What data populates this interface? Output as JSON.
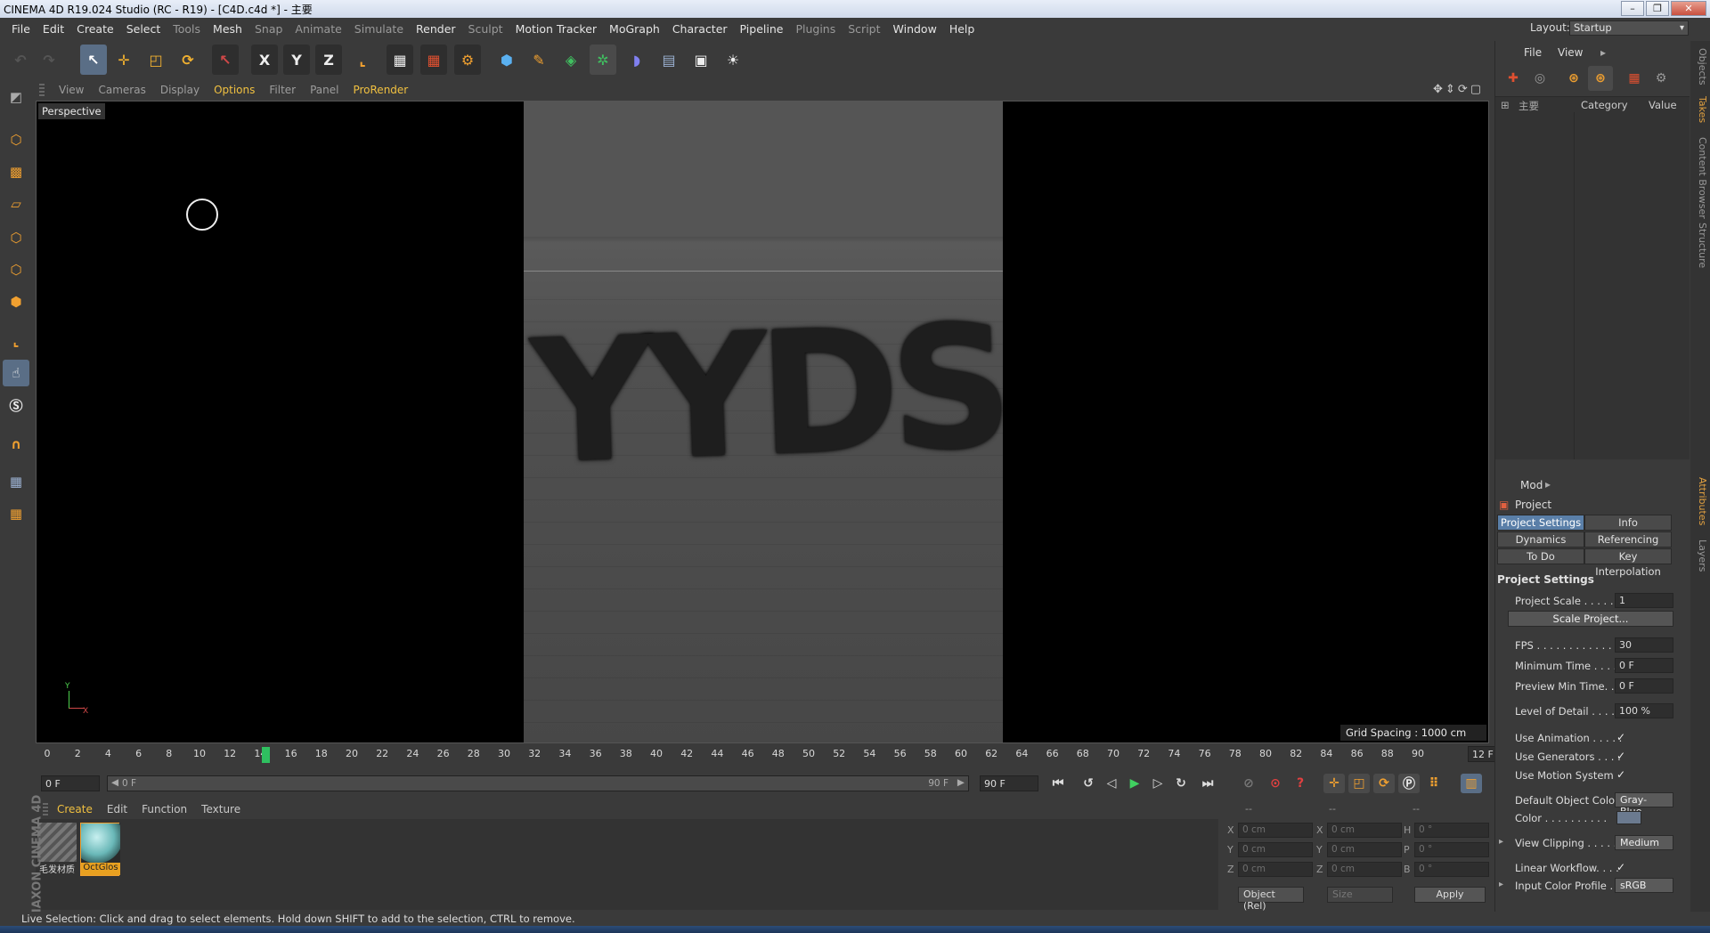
{
  "window": {
    "title": "CINEMA 4D R19.024 Studio (RC - R19) - [C4D.c4d *] - 主要",
    "buttons": [
      "–",
      "❐",
      "✕"
    ]
  },
  "menubar": {
    "items": [
      "File",
      "Edit",
      "Create",
      "Select",
      "Tools",
      "Mesh",
      "Snap",
      "Animate",
      "Simulate",
      "Render",
      "Sculpt",
      "Motion Tracker",
      "MoGraph",
      "Character",
      "Pipeline",
      "Plugins",
      "Script",
      "Window",
      "Help"
    ],
    "layout_label": "Layout:",
    "layout_value": "Startup"
  },
  "toolbar": {
    "icons": [
      "undo-icon",
      "redo-icon",
      "live-selection-icon",
      "move-icon",
      "scale-icon",
      "rotate-icon",
      "recent-tool-icon",
      "x-axis-icon",
      "y-axis-icon",
      "z-axis-icon",
      "coordinate-system-icon",
      "render-view-icon",
      "render-picture-viewer-icon",
      "render-settings-icon",
      "cube-icon",
      "pen-icon",
      "subdivision-icon",
      "cloner-icon",
      "deformer-icon",
      "floor-icon",
      "camera-icon",
      "light-icon"
    ],
    "axis_labels": [
      "X",
      "Y",
      "Z"
    ]
  },
  "left_tools": [
    "make-editable-icon",
    "model-mode-icon",
    "texture-mode-icon",
    "workplane-icon",
    "points-mode-icon",
    "edges-mode-icon",
    "polygons-mode-icon",
    "axis-mode-icon",
    "tweak-mode-icon",
    "solo-icon",
    "snap-icon",
    "workplane-lock-icon",
    "locked-workplane-icon"
  ],
  "viewport": {
    "menu": [
      "View",
      "Cameras",
      "Display",
      "Options",
      "Filter",
      "Panel",
      "ProRender"
    ],
    "highlighted_menu": "Options",
    "label": "Perspective",
    "scene_text": "YYDS",
    "axis_y": "Y",
    "axis_x": "X",
    "grid_spacing": "Grid Spacing : 1000 cm"
  },
  "timeline": {
    "ticks": [
      "0",
      "2",
      "4",
      "6",
      "8",
      "10",
      "12",
      "14",
      "16",
      "18",
      "20",
      "22",
      "24",
      "26",
      "28",
      "30",
      "32",
      "34",
      "36",
      "38",
      "40",
      "42",
      "44",
      "46",
      "48",
      "50",
      "52",
      "54",
      "56",
      "58",
      "60",
      "62",
      "64",
      "66",
      "68",
      "70",
      "72",
      "74",
      "76",
      "78",
      "80",
      "82",
      "84",
      "86",
      "88",
      "90"
    ],
    "current_frame": "12 F",
    "start_field": "0 F",
    "range_start": "0 F",
    "range_end": "90 F",
    "end_field": "90 F"
  },
  "materials": {
    "menu": [
      "Create",
      "Edit",
      "Function",
      "Texture"
    ],
    "items": [
      {
        "label": "毛发材质"
      },
      {
        "label": "OctGlos"
      }
    ]
  },
  "maxon_logo": "MAXON CINEMA 4D",
  "coordinates": {
    "headers": [
      "--",
      "--",
      "--"
    ],
    "rows": [
      {
        "pos_label": "X",
        "pos": "0 cm",
        "size_label": "X",
        "size": "0 cm",
        "rot_label": "H",
        "rot": "0 °"
      },
      {
        "pos_label": "Y",
        "pos": "0 cm",
        "size_label": "Y",
        "size": "0 cm",
        "rot_label": "P",
        "rot": "0 °"
      },
      {
        "pos_label": "Z",
        "pos": "0 cm",
        "size_label": "Z",
        "size": "0 cm",
        "rot_label": "B",
        "rot": "0 °"
      }
    ],
    "mode_dropdown": "Object (Rel)",
    "size_dropdown": "Size",
    "apply": "Apply"
  },
  "objects_panel": {
    "menu": [
      "File",
      "View"
    ],
    "columns": {
      "name": "主要",
      "category": "Category",
      "value": "Value"
    }
  },
  "attributes": {
    "menu": "Mod",
    "object": "Project",
    "tabs": [
      {
        "label": "Project Settings",
        "active": true
      },
      {
        "label": "Info",
        "active": false
      },
      {
        "label": "Dynamics",
        "active": false
      },
      {
        "label": "Referencing",
        "active": false
      },
      {
        "label": "To Do",
        "active": false
      },
      {
        "label": "Key Interpolation",
        "active": false
      }
    ],
    "section": "Project Settings",
    "project_scale_label": "Project Scale . . . . . .",
    "project_scale": "1",
    "scale_project_button": "Scale Project...",
    "fps_label": "FPS . . . . . . . . . . . . . .",
    "fps": "30",
    "min_time_label": "Minimum Time . . . . .",
    "min_time": "0 F",
    "preview_min_label": "Preview Min Time. . .",
    "preview_min": "0 F",
    "lod_label": "Level of Detail . . . . .",
    "lod": "100 %",
    "use_animation_label": "Use Animation . . . . .",
    "use_generators_label": "Use Generators . . . .",
    "use_motion_label": "Use Motion System",
    "default_color_label": "Default Object Color",
    "default_color": "Gray-Blue",
    "color_label": "Color . . . . . . . . . .",
    "view_clipping_label": "View Clipping . . . . .",
    "view_clipping": "Medium",
    "linear_workflow_label": "Linear Workflow. . . .",
    "input_profile_label": "Input Color Profile . .",
    "input_profile": "sRGB",
    "check": "✓"
  },
  "right_tabs": [
    "Objects",
    "Takes",
    "Content Browser",
    "Structure",
    "Attributes",
    "Layers"
  ],
  "status": "Live Selection: Click and drag to select elements. Hold down SHIFT to add to the selection, CTRL to remove.",
  "colors": {
    "accent_blue": "#5a7fa8",
    "highlight_orange": "#f0c040",
    "playhead_green": "#2fc060"
  }
}
